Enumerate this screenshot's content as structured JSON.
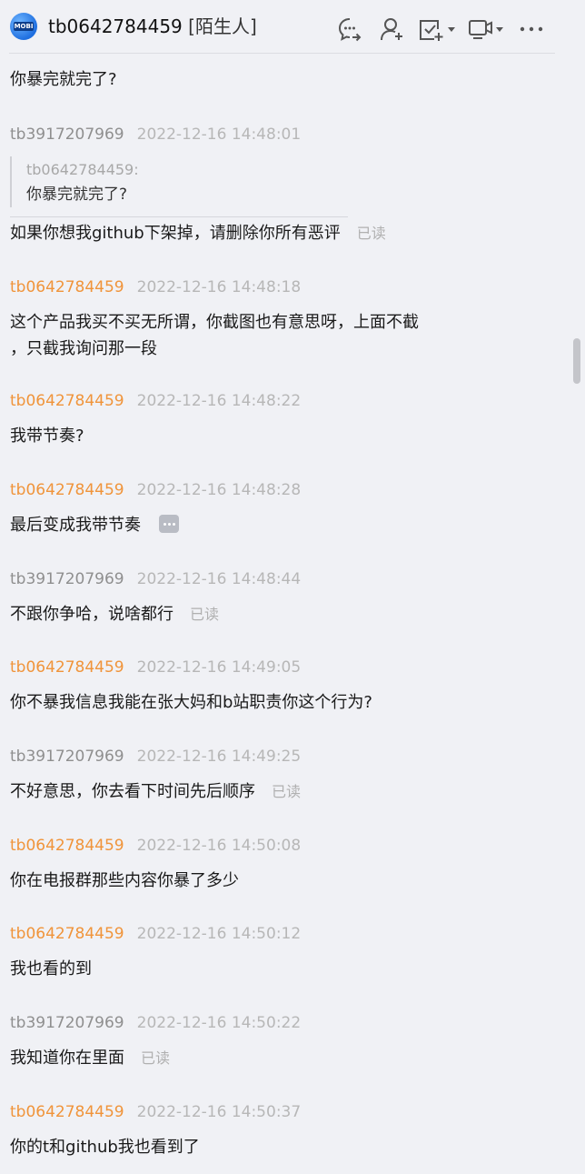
{
  "header": {
    "avatar_text": "MOBI",
    "contact_name": "tb0642784459",
    "contact_tag": "[陌生人]",
    "icons": [
      "chat-share-icon",
      "add-friend-icon",
      "check-task-icon",
      "video-call-icon",
      "more-icon"
    ]
  },
  "messages": [
    {
      "text": "你暴完就完了?"
    },
    {
      "sender": "tb3917207969",
      "time": "2022-12-16 14:48:01",
      "quote": {
        "name": "tb0642784459:",
        "text": "你暴完就完了?"
      },
      "text": "如果你想我github下架掉，请删除你所有恶评",
      "read": "已读"
    },
    {
      "sender": "tb0642784459",
      "time": "2022-12-16 14:48:18",
      "line1": "这个产品我买不买无所谓，你截图也有意思呀，上面不截",
      "line2": "，只截我询问那一段"
    },
    {
      "sender": "tb0642784459",
      "time": "2022-12-16 14:48:22",
      "text": "我带节奏?"
    },
    {
      "sender": "tb0642784459",
      "time": "2022-12-16 14:48:28",
      "text": "最后变成我带节奏"
    },
    {
      "sender": "tb3917207969",
      "time": "2022-12-16 14:48:44",
      "text": "不跟你争哈，说啥都行",
      "read": "已读"
    },
    {
      "sender": "tb0642784459",
      "time": "2022-12-16 14:49:05",
      "text": "你不暴我信息我能在张大妈和b站职责你这个行为?"
    },
    {
      "sender": "tb3917207969",
      "time": "2022-12-16 14:49:25",
      "text": "不好意思，你去看下时间先后顺序",
      "read": "已读"
    },
    {
      "sender": "tb0642784459",
      "time": "2022-12-16 14:50:08",
      "text": "你在电报群那些内容你暴了多少"
    },
    {
      "sender": "tb0642784459",
      "time": "2022-12-16 14:50:12",
      "text": "我也看的到"
    },
    {
      "sender": "tb3917207969",
      "time": "2022-12-16 14:50:22",
      "text": "我知道你在里面",
      "read": "已读"
    },
    {
      "sender": "tb0642784459",
      "time": "2022-12-16 14:50:37",
      "text": "你的t和github我也看到了"
    }
  ],
  "colors": {
    "other_sender": "#f0943a",
    "self_sender": "#8f8f8f",
    "timestamp": "#b7b7b7",
    "background": "#f0f1f5"
  }
}
